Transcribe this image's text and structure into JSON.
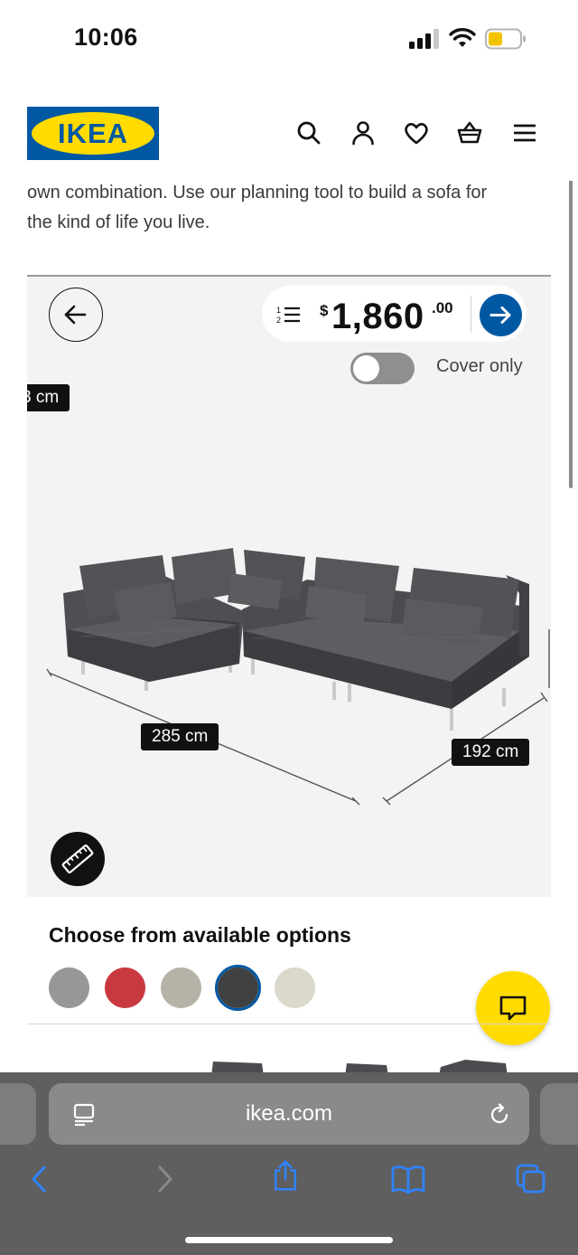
{
  "status_bar": {
    "time": "10:06"
  },
  "header": {
    "logo_text": "IKEA",
    "icons": [
      "search-icon",
      "profile-icon",
      "heart-icon",
      "basket-icon",
      "menu-icon"
    ]
  },
  "intro": {
    "line1": "own combination. Use our planning tool to build a sofa for",
    "line2": "the kind of life you live."
  },
  "planner": {
    "currency": "$",
    "price_int": "1,860",
    "price_dec": ".00",
    "toggle_label": "Cover only",
    "toggle_on": false,
    "dim_height": "3 cm",
    "dim_width": "285 cm",
    "dim_depth": "192 cm"
  },
  "options": {
    "title": "Choose from available options",
    "swatches": [
      {
        "color": "#979797",
        "selected": false
      },
      {
        "color": "#C8393F",
        "selected": false
      },
      {
        "color": "#B6B2A7",
        "selected": false
      },
      {
        "color": "#3F4143",
        "selected": true
      },
      {
        "color": "#DBD9CB",
        "selected": false
      }
    ]
  },
  "safari": {
    "url": "ikea.com"
  },
  "colors": {
    "brand_blue": "#0058A3",
    "brand_yellow": "#FFDB00"
  }
}
